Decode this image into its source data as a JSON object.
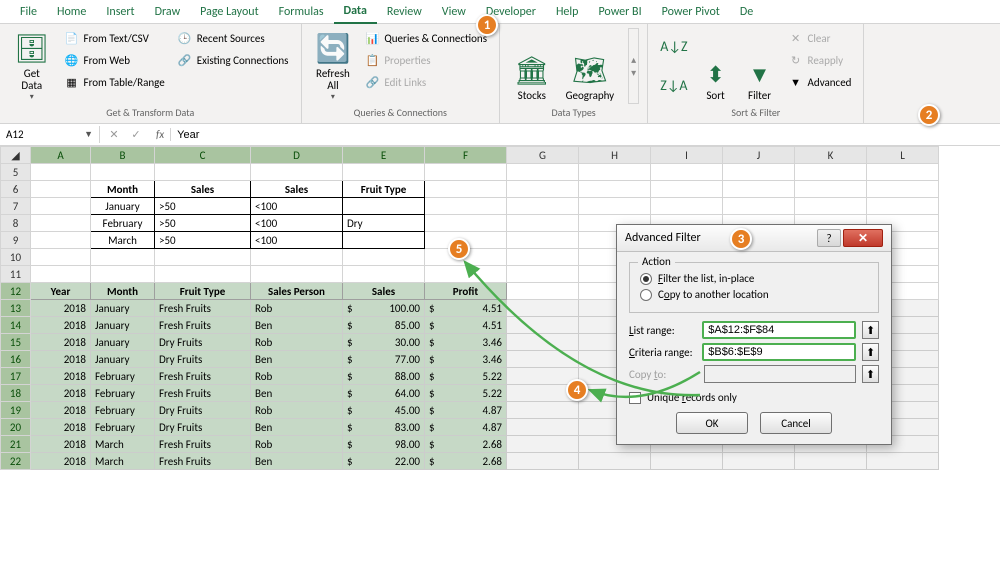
{
  "ribbon_tabs": [
    "File",
    "Home",
    "Insert",
    "Draw",
    "Page Layout",
    "Formulas",
    "Data",
    "Review",
    "View",
    "Developer",
    "Help",
    "Power BI",
    "Power Pivot",
    "De"
  ],
  "active_tab": "Data",
  "ribbon": {
    "get_data": "Get\nData",
    "from_text": "From Text/CSV",
    "from_web": "From Web",
    "from_table": "From Table/Range",
    "recent": "Recent Sources",
    "existing": "Existing Connections",
    "group1": "Get & Transform Data",
    "refresh": "Refresh\nAll",
    "queries": "Queries & Connections",
    "properties": "Properties",
    "edit_links": "Edit Links",
    "group2": "Queries & Connections",
    "stocks": "Stocks",
    "geography": "Geography",
    "group3": "Data Types",
    "sort_az": "A→Z",
    "sort_za": "Z→A",
    "sort": "Sort",
    "filter": "Filter",
    "clear": "Clear",
    "reapply": "Reapply",
    "advanced": "Advanced",
    "group4": "Sort & Filter"
  },
  "name_box": "A12",
  "formula_value": "Year",
  "columns": [
    "A",
    "B",
    "C",
    "D",
    "E",
    "F",
    "G",
    "H",
    "I",
    "J",
    "K",
    "L"
  ],
  "row_start": 5,
  "criteria": {
    "headers": [
      "Month",
      "Sales",
      "Sales",
      "Fruit Type"
    ],
    "rows": [
      [
        "January",
        ">50",
        "<100",
        ""
      ],
      [
        "February",
        ">50",
        "<100",
        "Dry"
      ],
      [
        "March",
        ">50",
        "<100",
        ""
      ]
    ]
  },
  "data": {
    "headers": [
      "Year",
      "Month",
      "Fruit Type",
      "Sales Person",
      "Sales",
      "Profit"
    ],
    "rows": [
      [
        "2018",
        "January",
        "Fresh Fruits",
        "Rob",
        "$",
        "100.00",
        "$",
        "4.51"
      ],
      [
        "2018",
        "January",
        "Fresh Fruits",
        "Ben",
        "$",
        "85.00",
        "$",
        "4.51"
      ],
      [
        "2018",
        "January",
        "Dry Fruits",
        "Rob",
        "$",
        "30.00",
        "$",
        "3.46"
      ],
      [
        "2018",
        "January",
        "Dry Fruits",
        "Ben",
        "$",
        "77.00",
        "$",
        "3.46"
      ],
      [
        "2018",
        "February",
        "Fresh Fruits",
        "Rob",
        "$",
        "88.00",
        "$",
        "5.22"
      ],
      [
        "2018",
        "February",
        "Fresh Fruits",
        "Ben",
        "$",
        "64.00",
        "$",
        "5.22"
      ],
      [
        "2018",
        "February",
        "Dry Fruits",
        "Rob",
        "$",
        "45.00",
        "$",
        "4.87"
      ],
      [
        "2018",
        "February",
        "Dry Fruits",
        "Ben",
        "$",
        "83.00",
        "$",
        "4.87"
      ],
      [
        "2018",
        "March",
        "Fresh Fruits",
        "Rob",
        "$",
        "98.00",
        "$",
        "2.68"
      ],
      [
        "2018",
        "March",
        "Fresh Fruits",
        "Ben",
        "$",
        "22.00",
        "$",
        "2.68"
      ]
    ]
  },
  "dialog": {
    "title": "Advanced Filter",
    "action": "Action",
    "radio1": "Filter the list, in-place",
    "radio2": "Copy to another location",
    "list_range_lbl": "List range:",
    "list_range": "$A$12:$F$84",
    "criteria_range_lbl": "Criteria range:",
    "criteria_range": "$B$6:$E$9",
    "copy_to_lbl": "Copy to:",
    "unique": "Unique records only",
    "ok": "OK",
    "cancel": "Cancel"
  },
  "callouts": {
    "c1": "1",
    "c2": "2",
    "c3": "3",
    "c4": "4",
    "c5": "5"
  }
}
